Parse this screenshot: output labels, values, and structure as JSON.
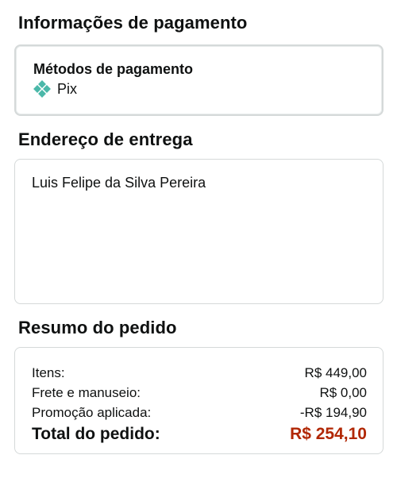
{
  "payment_section": {
    "title": "Informações de pagamento",
    "methods_label": "Métodos de pagamento",
    "method_name": "Pix",
    "method_icon": "pix-icon",
    "method_icon_color": "#4bb8a9"
  },
  "address_section": {
    "title": "Endereço de entrega",
    "recipient_name": "Luis Felipe da Silva Pereira"
  },
  "summary_section": {
    "title": "Resumo do pedido",
    "rows": [
      {
        "label": "Itens:",
        "value": "R$ 449,00"
      },
      {
        "label": "Frete e manuseio:",
        "value": "R$ 0,00"
      },
      {
        "label": "Promoção aplicada:",
        "value": "-R$ 194,90"
      }
    ],
    "total": {
      "label": "Total do pedido:",
      "value": "R$ 254,10",
      "color": "#b12704"
    }
  }
}
